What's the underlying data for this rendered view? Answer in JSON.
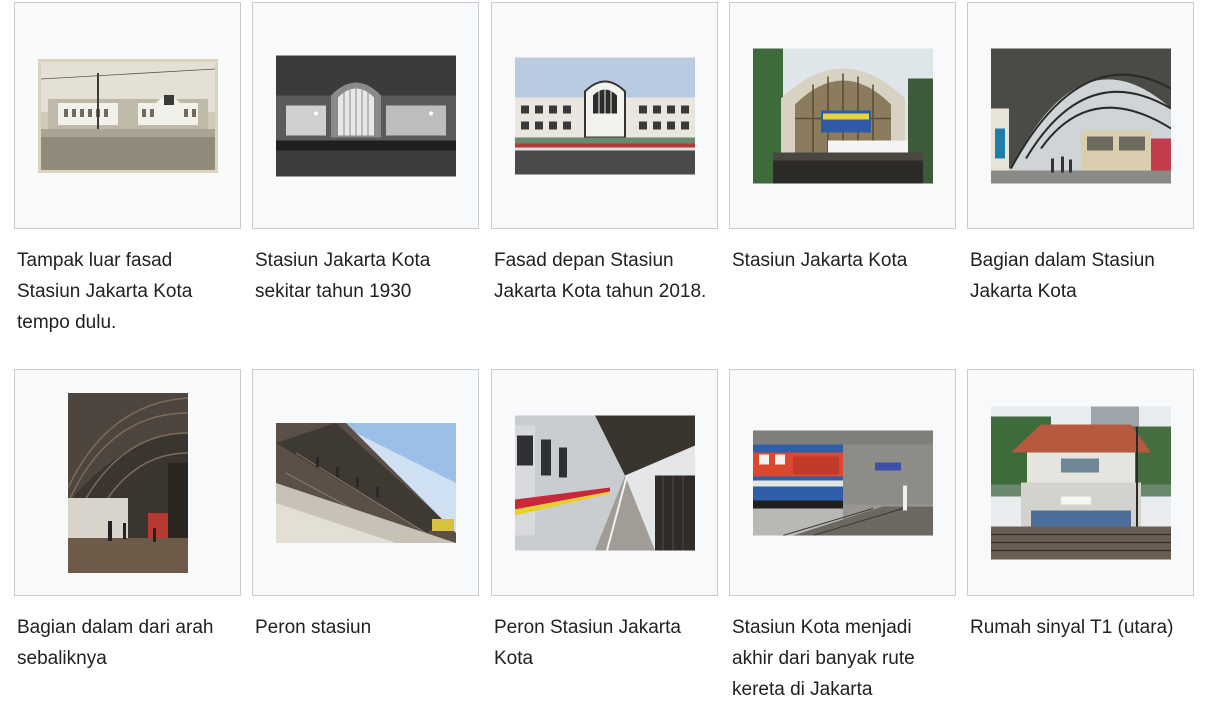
{
  "gallery": {
    "items": [
      {
        "caption": "Tampak luar fasad Stasiun Jakarta Kota tempo dulu.",
        "photo_icon": "vintage-station-photo-icon"
      },
      {
        "caption": "Stasiun Jakarta Kota sekitar tahun 1930",
        "photo_icon": "night-station-photo-icon"
      },
      {
        "caption": "Fasad depan Stasiun Jakarta Kota tahun 2018.",
        "photo_icon": "station-facade-photo-icon"
      },
      {
        "caption": "Stasiun Jakarta Kota",
        "photo_icon": "station-entrance-photo-icon"
      },
      {
        "caption": "Bagian dalam Stasiun Jakarta Kota",
        "photo_icon": "station-interior-photo-icon"
      },
      {
        "caption": "Bagian dalam dari arah sebaliknya",
        "photo_icon": "station-roof-photo-icon"
      },
      {
        "caption": "Peron stasiun",
        "photo_icon": "platform-photo-icon"
      },
      {
        "caption": "Peron Stasiun Jakarta Kota",
        "photo_icon": "train-platform-photo-icon"
      },
      {
        "caption": "Stasiun Kota menjadi akhir dari banyak rute kereta di Jakarta",
        "photo_icon": "locomotive-photo-icon"
      },
      {
        "caption": "Rumah sinyal T1 (utara)",
        "photo_icon": "signal-house-photo-icon"
      }
    ]
  }
}
